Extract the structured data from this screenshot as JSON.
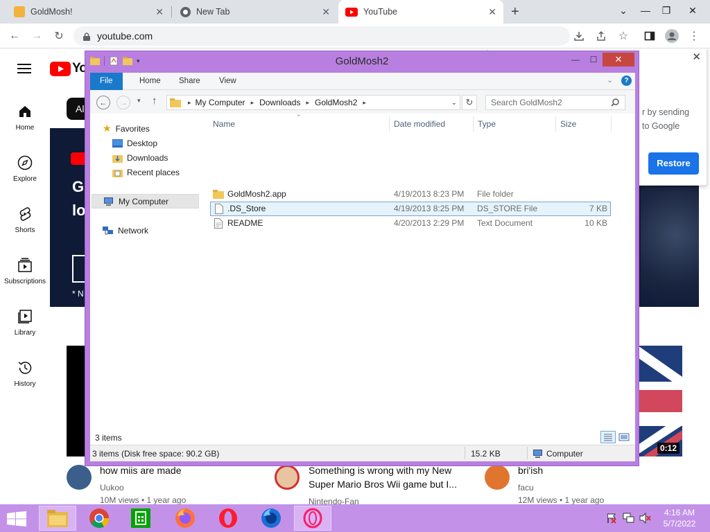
{
  "browser": {
    "tabs": [
      {
        "title": "GoldMosh!"
      },
      {
        "title": "New Tab"
      },
      {
        "title": "YouTube"
      }
    ],
    "url": "youtube.com"
  },
  "youtube": {
    "logo_text": "YouTube",
    "chip_partial": "Al",
    "nav": [
      {
        "label": "Home"
      },
      {
        "label": "Explore"
      },
      {
        "label": "Shorts"
      },
      {
        "label": "Subscriptions"
      },
      {
        "label": "Library"
      },
      {
        "label": "History"
      }
    ],
    "banner_line1": "G",
    "banner_line2": "lo",
    "banner_note": "* N",
    "restore_popup": {
      "text_line1": "r by sending",
      "text_line2": "to Google",
      "button": "Restore"
    },
    "video_duration": "0:12",
    "videos": [
      {
        "title": "how miis are made",
        "channel": "Uukoo",
        "meta": "10M views • 1 year ago"
      },
      {
        "title_line1": "Something is wrong with my New",
        "title_line2": "Super Mario Bros Wii game but I...",
        "channel": "Nintendo-Fan"
      },
      {
        "title": "bri'ish",
        "channel": "facu",
        "meta": "12M views • 1 year ago"
      }
    ]
  },
  "explorer": {
    "title": "GoldMosh2",
    "ribbon_tabs": [
      "File",
      "Home",
      "Share",
      "View"
    ],
    "breadcrumb": [
      "My Computer",
      "Downloads",
      "GoldMosh2"
    ],
    "search_placeholder": "Search GoldMosh2",
    "nav": {
      "favorites": "Favorites",
      "desktop": "Desktop",
      "downloads": "Downloads",
      "recent": "Recent places",
      "computer": "My Computer",
      "network": "Network"
    },
    "columns": {
      "name": "Name",
      "date": "Date modified",
      "type": "Type",
      "size": "Size"
    },
    "files": [
      {
        "name": "GoldMosh2.app",
        "date": "4/19/2013 8:23 PM",
        "type": "File folder",
        "size": ""
      },
      {
        "name": ".DS_Store",
        "date": "4/19/2013 8:25 PM",
        "type": "DS_STORE File",
        "size": "7 KB"
      },
      {
        "name": "README",
        "date": "4/20/2013 2:29 PM",
        "type": "Text Document",
        "size": "10 KB"
      }
    ],
    "item_count": "3 items",
    "status_left": "3 items (Disk free space: 90.2 GB)",
    "status_size": "15.2 KB",
    "status_location": "Computer"
  },
  "taskbar": {
    "time": "4:16 AM",
    "date": "5/7/2022"
  },
  "colors": {
    "explorer_frame": "#b87fe0",
    "taskbar": "#c392e8",
    "ribbon_file": "#1979ca",
    "youtube_red": "#ff0000",
    "restore_blue": "#1a73e8"
  }
}
